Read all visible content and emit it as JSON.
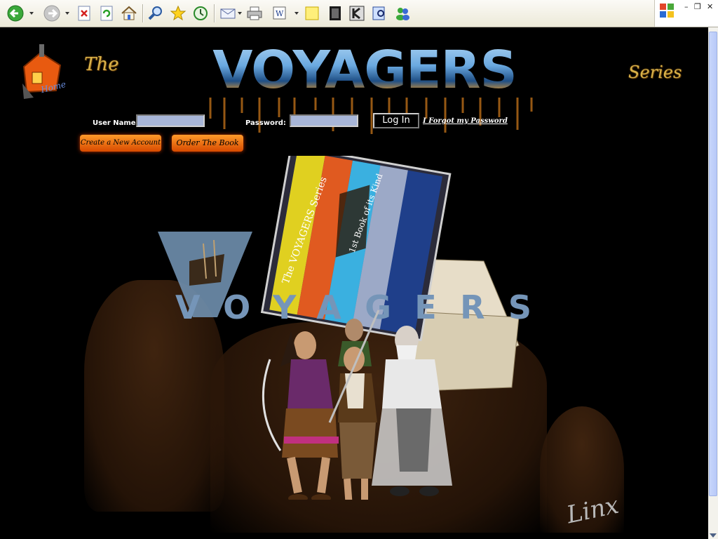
{
  "toolbar": {
    "buttons": [
      "back-icon",
      "forward-icon",
      "stop-icon",
      "refresh-icon",
      "home-icon",
      "search-icon",
      "favorites-icon",
      "history-icon",
      "mail-icon",
      "print-icon",
      "edit-icon",
      "notes-icon",
      "media-icon",
      "k-icon",
      "research-icon",
      "messenger-icon"
    ]
  },
  "header": {
    "home_label": "Home",
    "the_word": "The",
    "logo_word": "VOYAGERS",
    "series_word": "Series"
  },
  "login": {
    "username_label": "User Name:",
    "username_value": "",
    "password_label": "Password:",
    "password_value": "",
    "login_button": "Log In",
    "forgot_link": "I Forgot my Password"
  },
  "actions": {
    "create_account": "Create a New Account",
    "order_book": "Order The Book"
  },
  "artwork": {
    "logo_overlay": "VOYAGERS",
    "book_title": "The VOYAGERS Series",
    "book_tagline": "1st Book of its Kind",
    "signature": "Linx"
  },
  "colors": {
    "background": "#000000",
    "accent_orange": "#e8641a",
    "input_fill": "#a8b6d8",
    "script_gold": "#d8b24a"
  }
}
